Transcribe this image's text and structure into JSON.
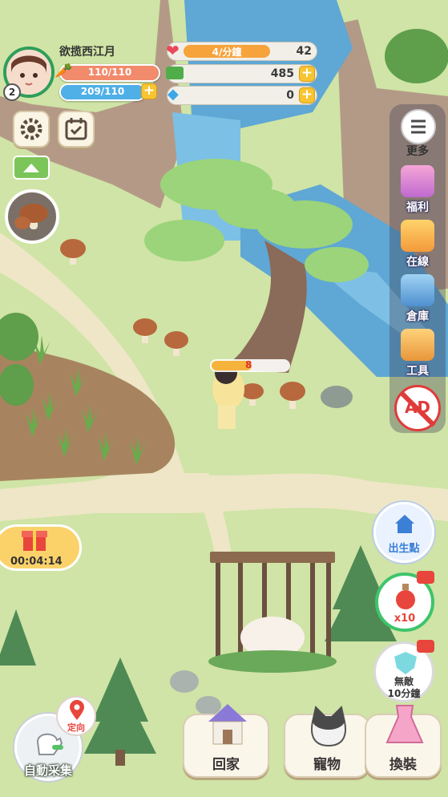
{
  "player": {
    "name": "欲揽西江月",
    "level": "2",
    "hp_text": "110/110",
    "energy_text": "209/110",
    "hp_fraction": 1.0,
    "energy_fraction": 1.0
  },
  "resources": {
    "hearts_rate": "4/分鐘",
    "hearts": "42",
    "cash": "485",
    "gems": "0"
  },
  "side_menu": {
    "more": "更多",
    "welfare": "福利",
    "online": "在線",
    "warehouse": "倉庫",
    "tools": "工具",
    "no_ads": "AD"
  },
  "gift": {
    "timer": "00:04:14"
  },
  "right_actions": {
    "spawn": "出生點",
    "potion_count": "x10",
    "invincible_line1": "無敵",
    "invincible_line2": "10分鐘"
  },
  "bottom": {
    "auto_collect": "自動采集",
    "locate": "定向",
    "home": "回家",
    "pets": "寵物",
    "dress": "換裝"
  },
  "scene": {
    "progress_number": "8"
  },
  "colors": {
    "hp_bar": "#f28a6c",
    "energy_bar": "#4fb0e8",
    "heart_bar": "#f6a33b",
    "accent_blue": "#3b7fd6"
  }
}
